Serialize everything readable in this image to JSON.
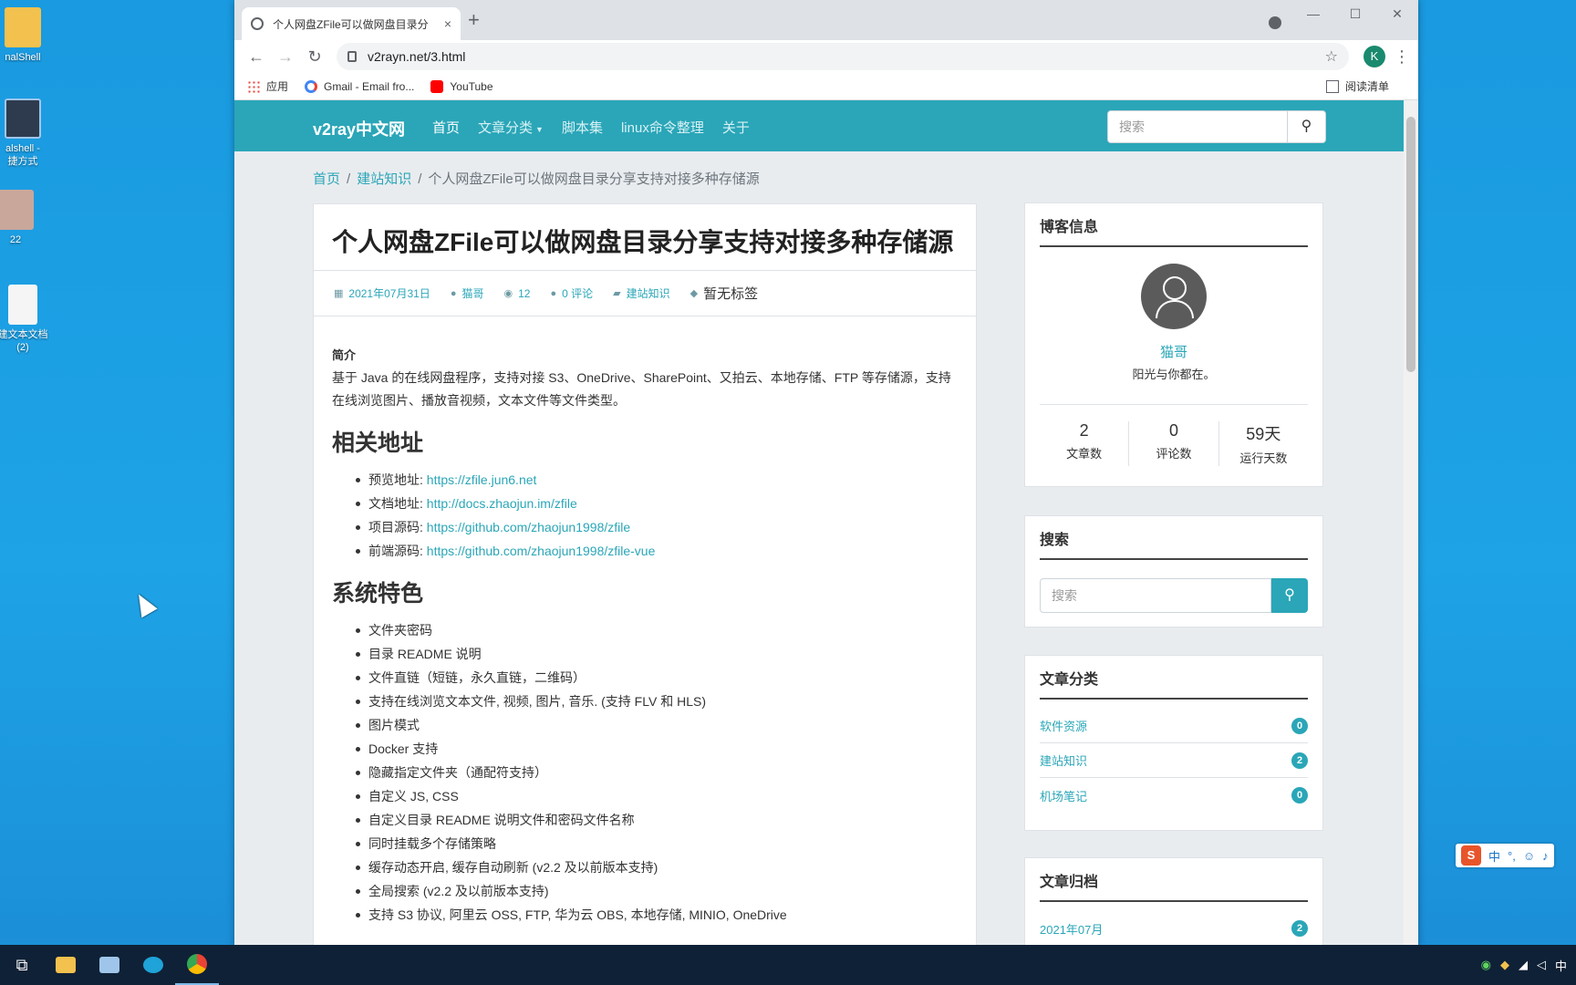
{
  "desktop": {
    "icons": [
      {
        "label": "nalShell",
        "color": "#f2c14e"
      },
      {
        "label": "alshell -\n捷方式",
        "color": "#2e3b4e"
      },
      {
        "label": "22",
        "color": "#c9a79b"
      },
      {
        "label": "建文本文档\n(2)",
        "color": "#f5f5f5"
      }
    ]
  },
  "browser": {
    "tab_title": "个人网盘ZFile可以做网盘目录分",
    "tab_close": "×",
    "new_tab": "+",
    "url": "v2rayn.net/3.html",
    "profile_initial": "K",
    "bookmarks": [
      {
        "label": "应用",
        "icon": "apps-icon"
      },
      {
        "label": "Gmail - Email fro...",
        "icon": "google-icon"
      },
      {
        "label": "YouTube",
        "icon": "youtube-icon"
      }
    ],
    "reading_list": "阅读清单"
  },
  "site": {
    "brand": "v2ray中文网",
    "nav": [
      "首页",
      "文章分类",
      "脚本集",
      "linux命令整理",
      "关于"
    ],
    "search_placeholder": "搜索",
    "accent": "#2aa6b8"
  },
  "breadcrumb": {
    "home": "首页",
    "category": "建站知识",
    "current": "个人网盘ZFile可以做网盘目录分享支持对接多种存储源"
  },
  "article": {
    "title": "个人网盘ZFile可以做网盘目录分享支持对接多种存储源",
    "meta": {
      "date": "2021年07月31日",
      "author": "猫哥",
      "views": "12",
      "comments": "0 评论",
      "category": "建站知识",
      "tags": "暂无标签"
    },
    "intro_heading": "简介",
    "intro_text": "基于 Java 的在线网盘程序，支持对接 S3、OneDrive、SharePoint、又拍云、本地存储、FTP 等存储源，支持在线浏览图片、播放音视频，文本文件等文件类型。",
    "links_heading": "相关地址",
    "links": [
      {
        "label": "预览地址: ",
        "url": "https://zfile.jun6.net"
      },
      {
        "label": "文档地址: ",
        "url": "http://docs.zhaojun.im/zfile"
      },
      {
        "label": "项目源码: ",
        "url": "https://github.com/zhaojun1998/zfile"
      },
      {
        "label": "前端源码: ",
        "url": "https://github.com/zhaojun1998/zfile-vue"
      }
    ],
    "features_heading": "系统特色",
    "features": [
      "文件夹密码",
      "目录 README 说明",
      "文件直链（短链，永久直链，二维码）",
      "支持在线浏览文本文件, 视频, 图片, 音乐. (支持 FLV 和 HLS)",
      "图片模式",
      "Docker 支持",
      "隐藏指定文件夹（通配符支持）",
      "自定义 JS, CSS",
      "自定义目录 README 说明文件和密码文件名称",
      "同时挂载多个存储策略",
      "缓存动态开启, 缓存自动刷新 (v2.2 及以前版本支持)",
      "全局搜索 (v2.2 及以前版本支持)",
      "支持 S3 协议, 阿里云 OSS, FTP, 华为云 OBS, 本地存储, MINIO, OneDrive"
    ]
  },
  "sidebar": {
    "blog_info": {
      "heading": "博客信息",
      "name": "猫哥",
      "motto": "阳光与你都在。",
      "stats": [
        {
          "value": "2",
          "label": "文章数"
        },
        {
          "value": "0",
          "label": "评论数"
        },
        {
          "value": "59天",
          "label": "运行天数"
        }
      ]
    },
    "search": {
      "heading": "搜索",
      "placeholder": "搜索"
    },
    "categories": {
      "heading": "文章分类",
      "items": [
        {
          "label": "软件资源",
          "count": "0"
        },
        {
          "label": "建站知识",
          "count": "2"
        },
        {
          "label": "机场笔记",
          "count": "0"
        }
      ]
    },
    "archive": {
      "heading": "文章归档",
      "items": [
        {
          "label": "2021年07月",
          "count": "2"
        }
      ]
    }
  },
  "ime": {
    "logo": "S",
    "mode": "中"
  }
}
